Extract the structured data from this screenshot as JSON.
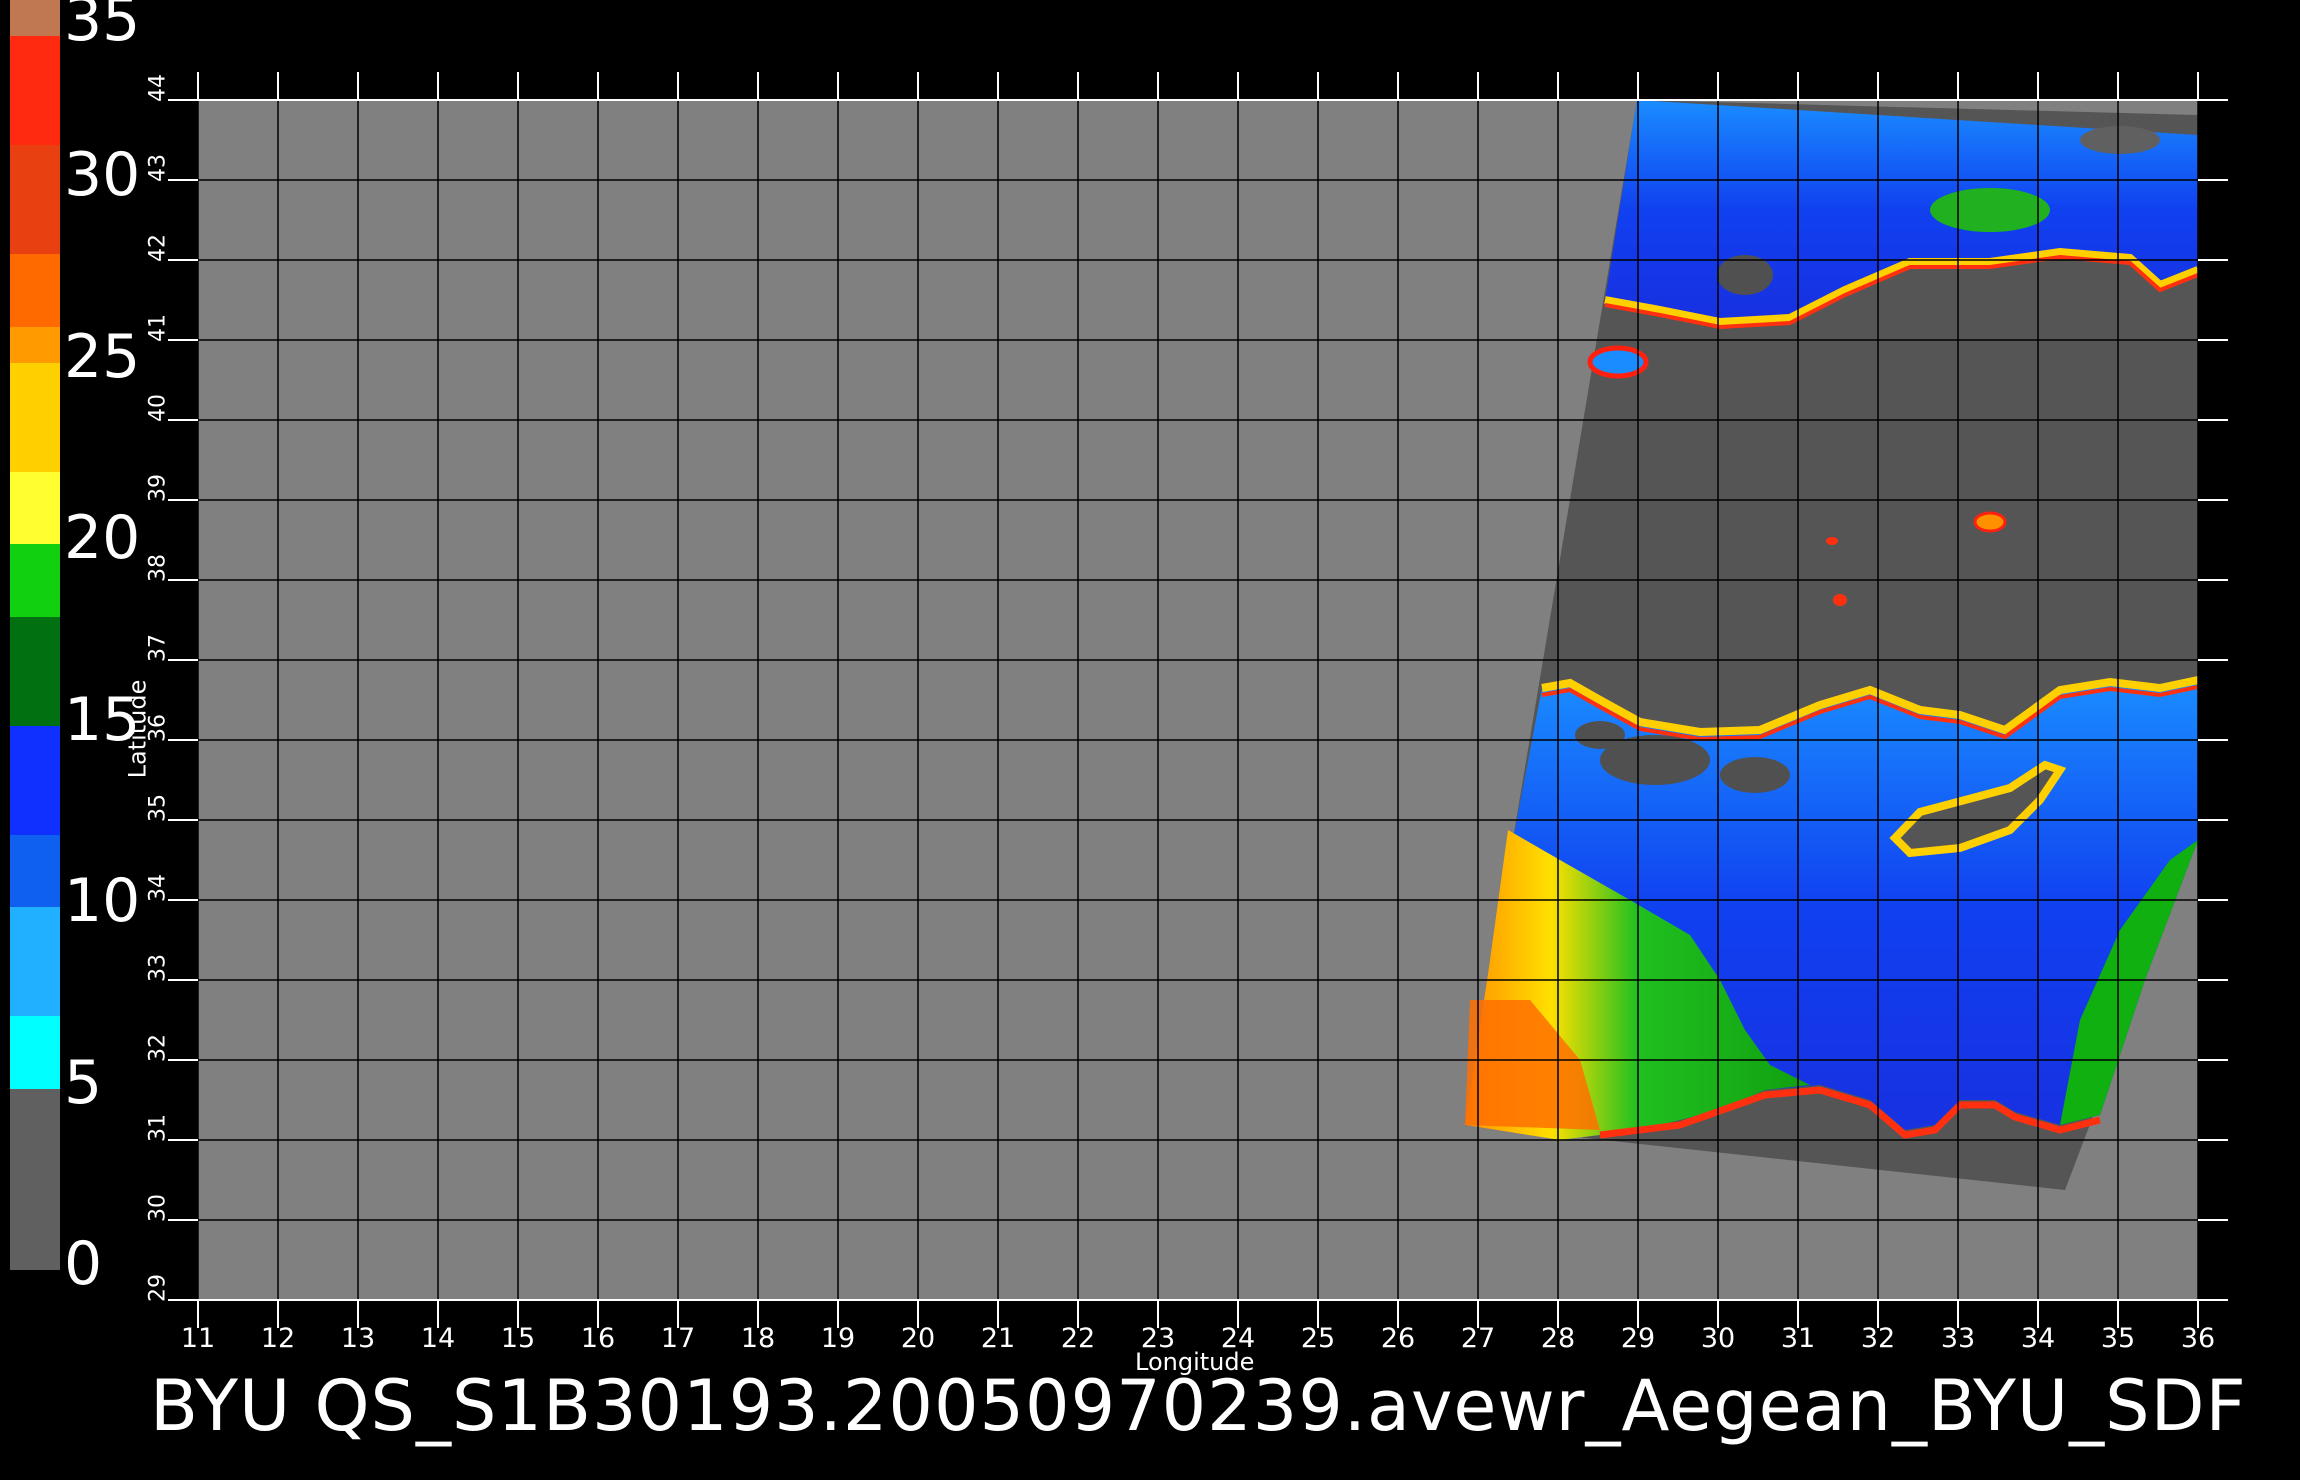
{
  "colorbar": {
    "labels": [
      "35",
      "30",
      "25",
      "20",
      "15",
      "10",
      "5",
      "0"
    ],
    "segments": [
      {
        "from": 35,
        "to": 34,
        "color": "#c07850"
      },
      {
        "from": 34,
        "to": 31,
        "color": "#ff2a10"
      },
      {
        "from": 31,
        "to": 28,
        "color": "#e84010"
      },
      {
        "from": 28,
        "to": 26,
        "color": "#ff6a00"
      },
      {
        "from": 26,
        "to": 25,
        "color": "#ff9a00"
      },
      {
        "from": 25,
        "to": 22,
        "color": "#ffd000"
      },
      {
        "from": 22,
        "to": 20,
        "color": "#ffff30"
      },
      {
        "from": 20,
        "to": 18,
        "color": "#10d010"
      },
      {
        "from": 18,
        "to": 15,
        "color": "#007010"
      },
      {
        "from": 15,
        "to": 12,
        "color": "#1030ff"
      },
      {
        "from": 12,
        "to": 10,
        "color": "#1060f0"
      },
      {
        "from": 10,
        "to": 7,
        "color": "#20b0ff"
      },
      {
        "from": 7,
        "to": 5,
        "color": "#00ffff"
      },
      {
        "from": 5,
        "to": 0,
        "color": "#606060"
      }
    ]
  },
  "axes": {
    "xlabel": "Longitude",
    "ylabel": "Latitude",
    "lon_ticks": [
      "11",
      "12",
      "13",
      "14",
      "15",
      "16",
      "17",
      "18",
      "19",
      "20",
      "21",
      "22",
      "23",
      "24",
      "25",
      "26",
      "27",
      "28",
      "29",
      "30",
      "31",
      "32",
      "33",
      "34",
      "35",
      "36"
    ],
    "lat_ticks": [
      "29",
      "30",
      "31",
      "32",
      "33",
      "34",
      "35",
      "36",
      "37",
      "38",
      "39",
      "40",
      "41",
      "42",
      "43",
      "44"
    ],
    "lon_range": [
      11,
      36
    ],
    "lat_range": [
      29,
      44
    ],
    "grid": true
  },
  "colors": {
    "map_background": "#808080",
    "swath_land": "#555555",
    "grid_line": "#000000"
  },
  "footer": {
    "text": "BYU  QS_S1B30193.20050970239.avewr_Aegean_BYU_SDF"
  }
}
